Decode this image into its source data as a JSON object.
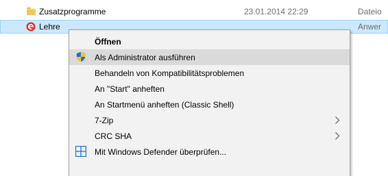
{
  "files": [
    {
      "name": "Zusatzprogramme",
      "date": "23.01.2014 22:29",
      "type": "Dateio",
      "icon": "folder-icon"
    },
    {
      "name": "Lehre",
      "date": "",
      "type": "Anwer",
      "icon": "app-icon"
    }
  ],
  "context_menu": {
    "items": [
      {
        "label": "Öffnen",
        "bold": true,
        "icon": "",
        "submenu": false
      },
      {
        "label": "Als Administrator ausführen",
        "bold": false,
        "icon": "uac-shield-icon",
        "submenu": false
      },
      {
        "label": "Behandeln von Kompatibilitätsproblemen",
        "bold": false,
        "icon": "",
        "submenu": false
      },
      {
        "label": "An \"Start\" anheften",
        "bold": false,
        "icon": "",
        "submenu": false
      },
      {
        "label": "An Startmenü anheften (Classic Shell)",
        "bold": false,
        "icon": "",
        "submenu": false
      },
      {
        "label": "7-Zip",
        "bold": false,
        "icon": "",
        "submenu": true
      },
      {
        "label": "CRC SHA",
        "bold": false,
        "icon": "",
        "submenu": true
      },
      {
        "label": "Mit Windows Defender überprüfen...",
        "bold": false,
        "icon": "windows-defender-icon",
        "submenu": false
      }
    ]
  },
  "colors": {
    "selection_bg": "#cce8ff",
    "menu_bg": "#f2f2f2",
    "menu_hover": "#dadada",
    "folder": "#f0c85a",
    "app_icon": "#e02b2b"
  }
}
